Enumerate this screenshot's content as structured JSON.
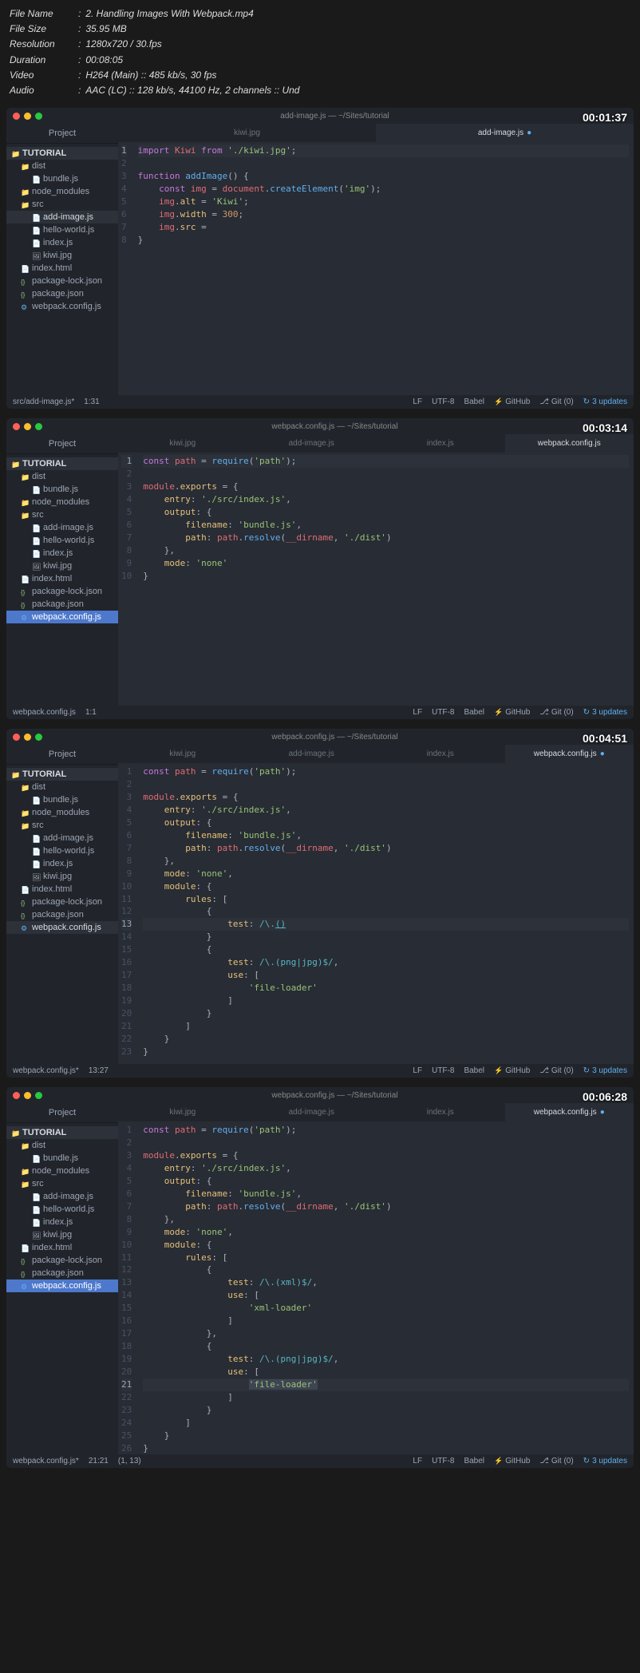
{
  "meta": {
    "filename_label": "File Name",
    "filename": "2. Handling Images With Webpack.mp4",
    "filesize_label": "File Size",
    "filesize": "35.95 MB",
    "resolution_label": "Resolution",
    "resolution": "1280x720 / 30.fps",
    "duration_label": "Duration",
    "duration": "00:08:05",
    "video_label": "Video",
    "video": "H264 (Main) :: 485 kb/s, 30 fps",
    "audio_label": "Audio",
    "audio": "AAC (LC) :: 128 kb/s, 44100 Hz, 2 channels :: Und"
  },
  "tree": {
    "root": "TUTORIAL",
    "dist": "dist",
    "bundle": "bundle.js",
    "node_modules": "node_modules",
    "src": "src",
    "add_image": "add-image.js",
    "hello_world": "hello-world.js",
    "index_js": "index.js",
    "kiwi": "kiwi.jpg",
    "index_html": "index.html",
    "pkg_lock": "package-lock.json",
    "pkg": "package.json",
    "webpack": "webpack.config.js"
  },
  "sidebar_header": "Project",
  "titlebars": {
    "w1": "add-image.js — ~/Sites/tutorial",
    "w2": "webpack.config.js — ~/Sites/tutorial",
    "w3": "webpack.config.js — ~/Sites/tutorial",
    "w4": "webpack.config.js — ~/Sites/tutorial"
  },
  "timestamps": {
    "w1": "00:01:37",
    "w2": "00:03:14",
    "w3": "00:04:51",
    "w4": "00:06:28"
  },
  "tabs": {
    "kiwi": "kiwi.jpg",
    "add_image": "add-image.js",
    "index": "index.js",
    "webpack": "webpack.config.js"
  },
  "status": {
    "w1_path": "src/add-image.js*",
    "w1_pos": "1:31",
    "w2_path": "webpack.config.js",
    "w2_pos": "1:1",
    "w3_path": "webpack.config.js*",
    "w3_pos": "13:27",
    "w4_path": "webpack.config.js*",
    "w4_pos": "21:21",
    "w4_sel": "(1, 13)",
    "lf": "LF",
    "enc": "UTF-8",
    "lang": "Babel",
    "github": "GitHub",
    "git": "Git (0)",
    "updates": "3 updates"
  },
  "code": {
    "w1": {
      "l1": "import Kiwi from './kiwi.jpg';",
      "l3": "function addImage() {",
      "l4": "    const img = document.createElement('img');",
      "l5": "    img.alt = 'Kiwi';",
      "l6": "    img.width = 300;",
      "l7": "    img.src = ",
      "l8": "}"
    },
    "w2": {
      "l1": "const path = require('path');",
      "l3": "module.exports = {",
      "l4": "    entry: './src/index.js',",
      "l5": "    output: {",
      "l6": "        filename: 'bundle.js',",
      "l7": "        path: path.resolve(__dirname, './dist')",
      "l8": "    },",
      "l9": "    mode: 'none'",
      "l10": "}"
    },
    "w3": {
      "l1": "const path = require('path');",
      "l3": "module.exports = {",
      "l4": "    entry: './src/index.js',",
      "l5": "    output: {",
      "l6": "        filename: 'bundle.js',",
      "l7": "        path: path.resolve(__dirname, './dist')",
      "l8": "    },",
      "l9": "    mode: 'none',",
      "l10": "    module: {",
      "l11": "        rules: [",
      "l12": "            {",
      "l13": "                test: /\\.()",
      "l14": "            }",
      "l15": "            {",
      "l16": "                test: /\\.(png|jpg)$/,",
      "l17": "                use: [",
      "l18": "                    'file-loader'",
      "l19": "                ]",
      "l20": "            }",
      "l21": "        ]",
      "l22": "    }",
      "l23": "}"
    },
    "w4": {
      "l1": "const path = require('path');",
      "l3": "module.exports = {",
      "l4": "    entry: './src/index.js',",
      "l5": "    output: {",
      "l6": "        filename: 'bundle.js',",
      "l7": "        path: path.resolve(__dirname, './dist')",
      "l8": "    },",
      "l9": "    mode: 'none',",
      "l10": "    module: {",
      "l11": "        rules: [",
      "l12": "            {",
      "l13": "                test: /\\.(xml)$/,",
      "l14": "                use: [",
      "l15": "                    'xml-loader'",
      "l16": "                ]",
      "l17": "            },",
      "l18": "            {",
      "l19": "                test: /\\.(png|jpg)$/,",
      "l20": "                use: [",
      "l21": "                    'file-loader'",
      "l22": "                ]",
      "l23": "            }",
      "l24": "        ]",
      "l25": "    }",
      "l26": "}"
    }
  }
}
